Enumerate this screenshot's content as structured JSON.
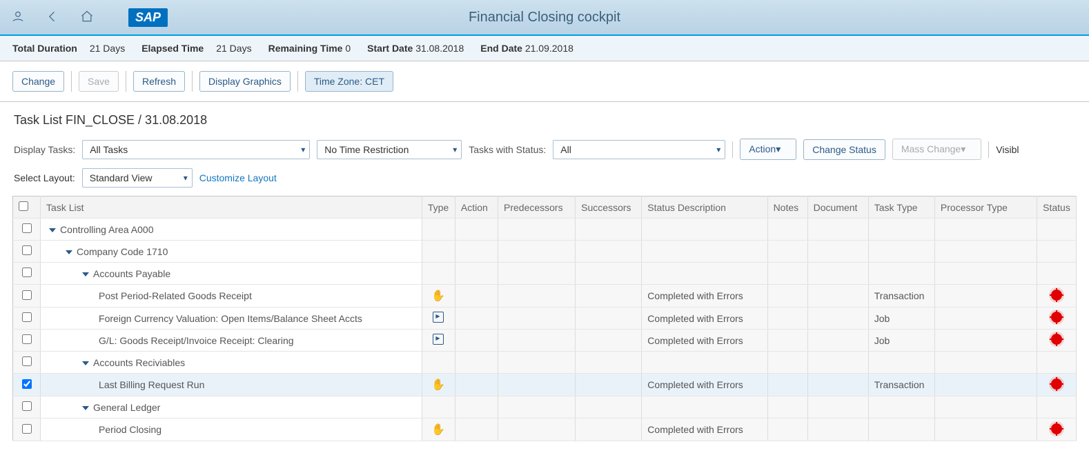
{
  "header": {
    "title": "Financial Closing cockpit",
    "sap_logo": "SAP"
  },
  "info": {
    "total_duration_label": "Total Duration",
    "total_duration": "21 Days",
    "elapsed_label": "Elapsed Time",
    "elapsed": "21 Days",
    "remaining_label": "Remaining Time",
    "remaining": "0",
    "start_label": "Start Date",
    "start": "31.08.2018",
    "end_label": "End Date",
    "end": "21.09.2018"
  },
  "toolbar": {
    "change": "Change",
    "save": "Save",
    "refresh": "Refresh",
    "display_graphics": "Display Graphics",
    "timezone": "Time Zone: CET"
  },
  "section_title": "Task List FIN_CLOSE / 31.08.2018",
  "filters": {
    "display_tasks_label": "Display Tasks:",
    "display_tasks_value": "All Tasks",
    "time_restriction": "No Time Restriction",
    "status_label": "Tasks with Status:",
    "status_value": "All",
    "action": "Action",
    "change_status": "Change Status",
    "mass_change": "Mass Change",
    "visible": "Visibl",
    "select_layout_label": "Select Layout:",
    "select_layout_value": "Standard View",
    "customize": "Customize Layout"
  },
  "columns": {
    "task_list": "Task List",
    "type": "Type",
    "action": "Action",
    "pred": "Predecessors",
    "succ": "Successors",
    "status_desc": "Status Description",
    "notes": "Notes",
    "document": "Document",
    "task_type": "Task Type",
    "processor": "Processor Type",
    "status": "Status"
  },
  "rows": [
    {
      "indent": 0,
      "expand": true,
      "label": "Controlling Area A000",
      "type": "",
      "status_desc": "",
      "task_type": "",
      "status": "",
      "checked": false
    },
    {
      "indent": 1,
      "expand": true,
      "label": "Company Code 1710",
      "type": "",
      "status_desc": "",
      "task_type": "",
      "status": "",
      "checked": false
    },
    {
      "indent": 2,
      "expand": true,
      "label": "Accounts Payable",
      "type": "",
      "status_desc": "",
      "task_type": "",
      "status": "",
      "checked": false
    },
    {
      "indent": 3,
      "expand": false,
      "label": "Post Period-Related Goods Receipt",
      "type": "hand",
      "status_desc": "Completed with Errors",
      "task_type": "Transaction",
      "status": "error",
      "checked": false
    },
    {
      "indent": 3,
      "expand": false,
      "label": "Foreign Currency Valuation: Open Items/Balance Sheet Accts",
      "type": "job",
      "status_desc": "Completed with Errors",
      "task_type": "Job",
      "status": "error",
      "checked": false
    },
    {
      "indent": 3,
      "expand": false,
      "label": "G/L: Goods Receipt/Invoice Receipt: Clearing",
      "type": "job",
      "status_desc": "Completed with Errors",
      "task_type": "Job",
      "status": "error",
      "checked": false
    },
    {
      "indent": 2,
      "expand": true,
      "label": "Accounts Reciviables",
      "type": "",
      "status_desc": "",
      "task_type": "",
      "status": "",
      "checked": false
    },
    {
      "indent": 3,
      "expand": false,
      "label": "Last Billing Request Run",
      "type": "hand",
      "status_desc": "Completed with Errors",
      "task_type": "Transaction",
      "status": "error",
      "checked": true
    },
    {
      "indent": 2,
      "expand": true,
      "label": "General Ledger",
      "type": "",
      "status_desc": "",
      "task_type": "",
      "status": "",
      "checked": false
    },
    {
      "indent": 3,
      "expand": false,
      "label": "Period Closing",
      "type": "hand",
      "status_desc": "Completed with Errors",
      "task_type": "",
      "status": "error",
      "checked": false
    }
  ]
}
